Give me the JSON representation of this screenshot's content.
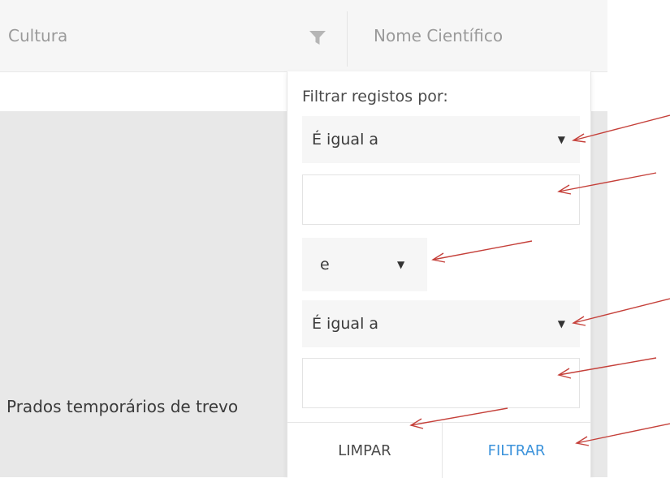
{
  "grid": {
    "columns": [
      {
        "label": "Cultura"
      },
      {
        "label": "Nome Científico"
      }
    ],
    "rows": [
      {
        "cultura": "Prados temporários de trevo"
      }
    ]
  },
  "filter_popup": {
    "label": "Filtrar registos por:",
    "first_condition": {
      "operator": "É igual a",
      "value": ""
    },
    "logic": "e",
    "second_condition": {
      "operator": "É igual a",
      "value": ""
    },
    "clear_label": "LIMPAR",
    "filter_label": "FILTRAR"
  },
  "icons": {
    "filter": "funnel-icon",
    "dropdown": "caret-down-icon"
  },
  "colors": {
    "primary": "#3c93db",
    "annotation_arrow": "#c5403a",
    "header_bg": "#f6f6f6",
    "row_bg": "#e8e8e8"
  }
}
